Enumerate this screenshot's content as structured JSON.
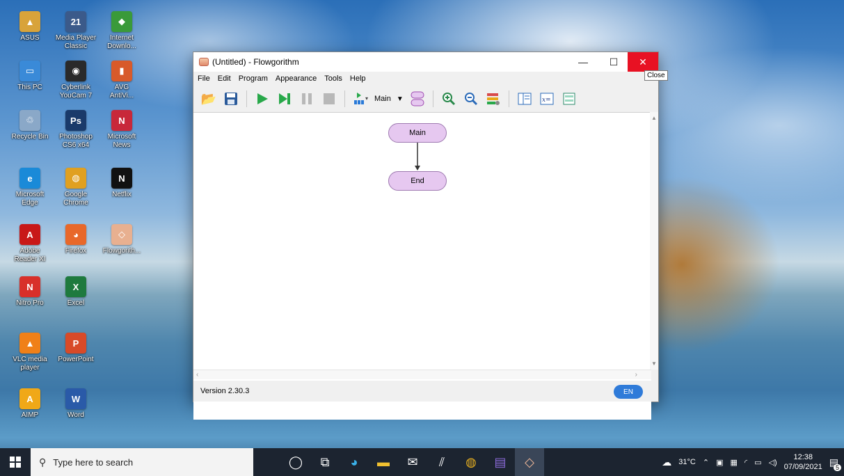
{
  "desktop": {
    "icons": [
      {
        "label_lines": [
          "ASUS"
        ],
        "color": "#d8a33a",
        "glyph": "▲"
      },
      {
        "label_lines": [
          "Media Player",
          "Classic"
        ],
        "color": "#3b5a8a",
        "glyph": "21"
      },
      {
        "label_lines": [
          "Internet",
          "Downlo..."
        ],
        "color": "#3a9a3a",
        "glyph": "◆"
      },
      {
        "label_lines": [
          "This PC"
        ],
        "color": "#3a8ad8",
        "glyph": "▭"
      },
      {
        "label_lines": [
          "Cyberlink",
          "YouCam 7"
        ],
        "color": "#2a2a2a",
        "glyph": "◉"
      },
      {
        "label_lines": [
          "AVG",
          "AntiVi..."
        ],
        "color": "#d85a2a",
        "glyph": "▮"
      },
      {
        "label_lines": [
          "Recycle Bin"
        ],
        "color": "#8aa8c8",
        "glyph": "♲"
      },
      {
        "label_lines": [
          "Photoshop",
          "CS6 x64"
        ],
        "color": "#1a3a6a",
        "glyph": "Ps"
      },
      {
        "label_lines": [
          "Microsoft",
          "News"
        ],
        "color": "#c8283a",
        "glyph": "N"
      },
      {
        "label_lines": [
          "Microsoft",
          "Edge"
        ],
        "color": "#1a8ad8",
        "glyph": "e"
      },
      {
        "label_lines": [
          "Google",
          "Chrome"
        ],
        "color": "#e0a020",
        "glyph": "◍"
      },
      {
        "label_lines": [
          "Netflix"
        ],
        "color": "#111111",
        "glyph": "N"
      },
      {
        "label_lines": [
          "Adobe",
          "Reader XI"
        ],
        "color": "#c81818",
        "glyph": "A"
      },
      {
        "label_lines": [
          "Firefox"
        ],
        "color": "#e8682a",
        "glyph": "◕"
      },
      {
        "label_lines": [
          "Flowgorith..."
        ],
        "color": "#e8b090",
        "glyph": "◇"
      },
      {
        "label_lines": [
          "Nitro Pro"
        ],
        "color": "#d8302a",
        "glyph": "N"
      },
      {
        "label_lines": [
          "Excel"
        ],
        "color": "#1e7a3e",
        "glyph": "X"
      },
      {
        "label_lines": [
          "VLC media",
          "player"
        ],
        "color": "#f08018",
        "glyph": "▲"
      },
      {
        "label_lines": [
          "PowerPoint"
        ],
        "color": "#d84a28",
        "glyph": "P"
      },
      {
        "label_lines": [
          "AIMP"
        ],
        "color": "#f0a818",
        "glyph": "A"
      },
      {
        "label_lines": [
          "Word"
        ],
        "color": "#2a5aa8",
        "glyph": "W"
      }
    ]
  },
  "window": {
    "title": "(Untitled) - Flowgorithm",
    "close_tooltip": "Close",
    "menu": [
      "File",
      "Edit",
      "Program",
      "Appearance",
      "Tools",
      "Help"
    ],
    "toolbar": {
      "function_select": "Main"
    },
    "flowchart": {
      "nodes": [
        "Main",
        "End"
      ]
    },
    "status": {
      "version": "Version 2.30.3",
      "language": "EN"
    }
  },
  "taskbar": {
    "search_placeholder": "Type here to search",
    "weather": "31°C",
    "time": "12:38",
    "date": "07/09/2021",
    "notifications_count": "5"
  }
}
